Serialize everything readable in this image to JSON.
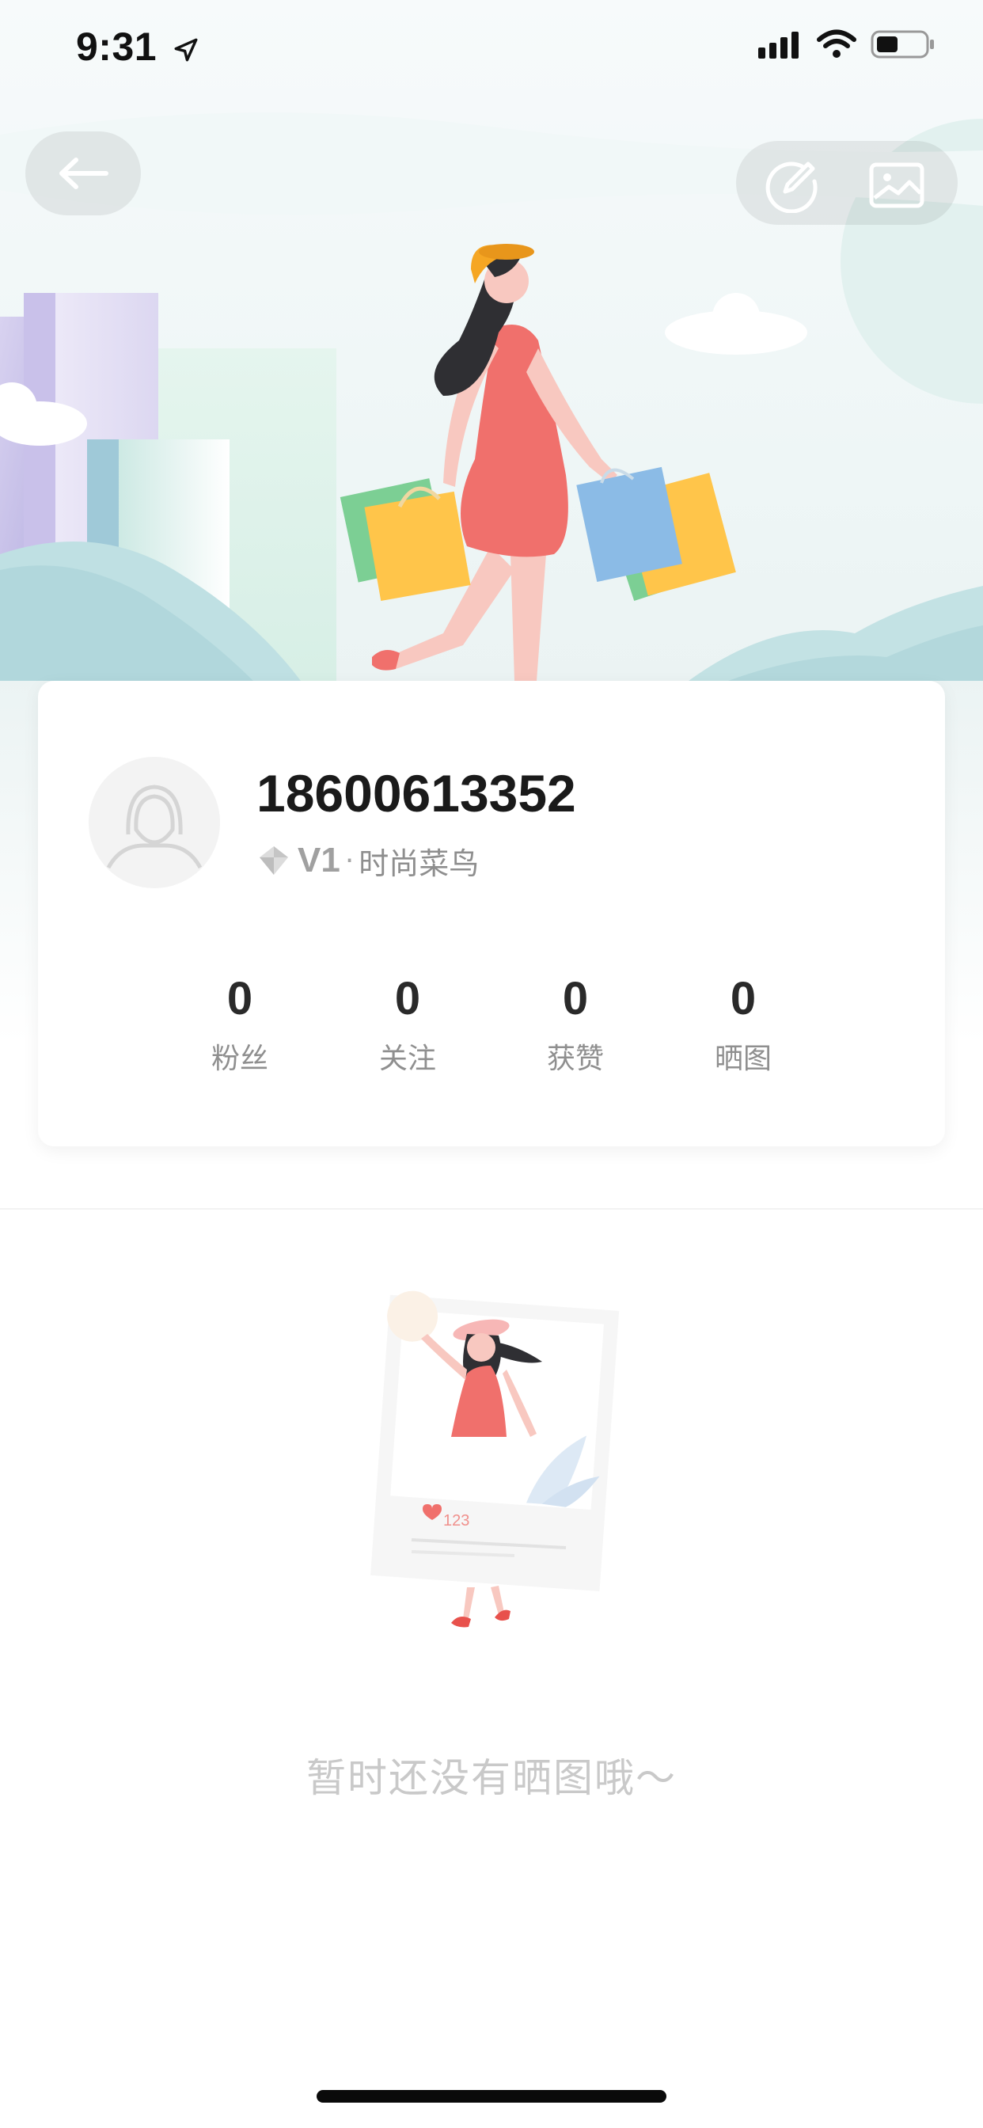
{
  "status_bar": {
    "time": "9:31"
  },
  "profile": {
    "phone": "18600613352",
    "level_code": "V1",
    "level_separator": "·",
    "level_title": "时尚菜鸟"
  },
  "stats": [
    {
      "value": "0",
      "label": "粉丝"
    },
    {
      "value": "0",
      "label": "关注"
    },
    {
      "value": "0",
      "label": "获赞"
    },
    {
      "value": "0",
      "label": "晒图"
    }
  ],
  "empty_state": {
    "message": "暂时还没有晒图哦～",
    "illustration_likes": "123"
  },
  "icons": {
    "back": "arrow-left-icon",
    "edit": "edit-icon",
    "image": "image-icon",
    "level": "diamond-icon",
    "navigation": "location-arrow-icon"
  },
  "colors": {
    "accent_red": "#f0706c",
    "bag_yellow": "#ffc54a",
    "bag_blue": "#8bbbe6",
    "text_primary": "#1a1a1a",
    "text_muted": "#8f8f8f"
  }
}
